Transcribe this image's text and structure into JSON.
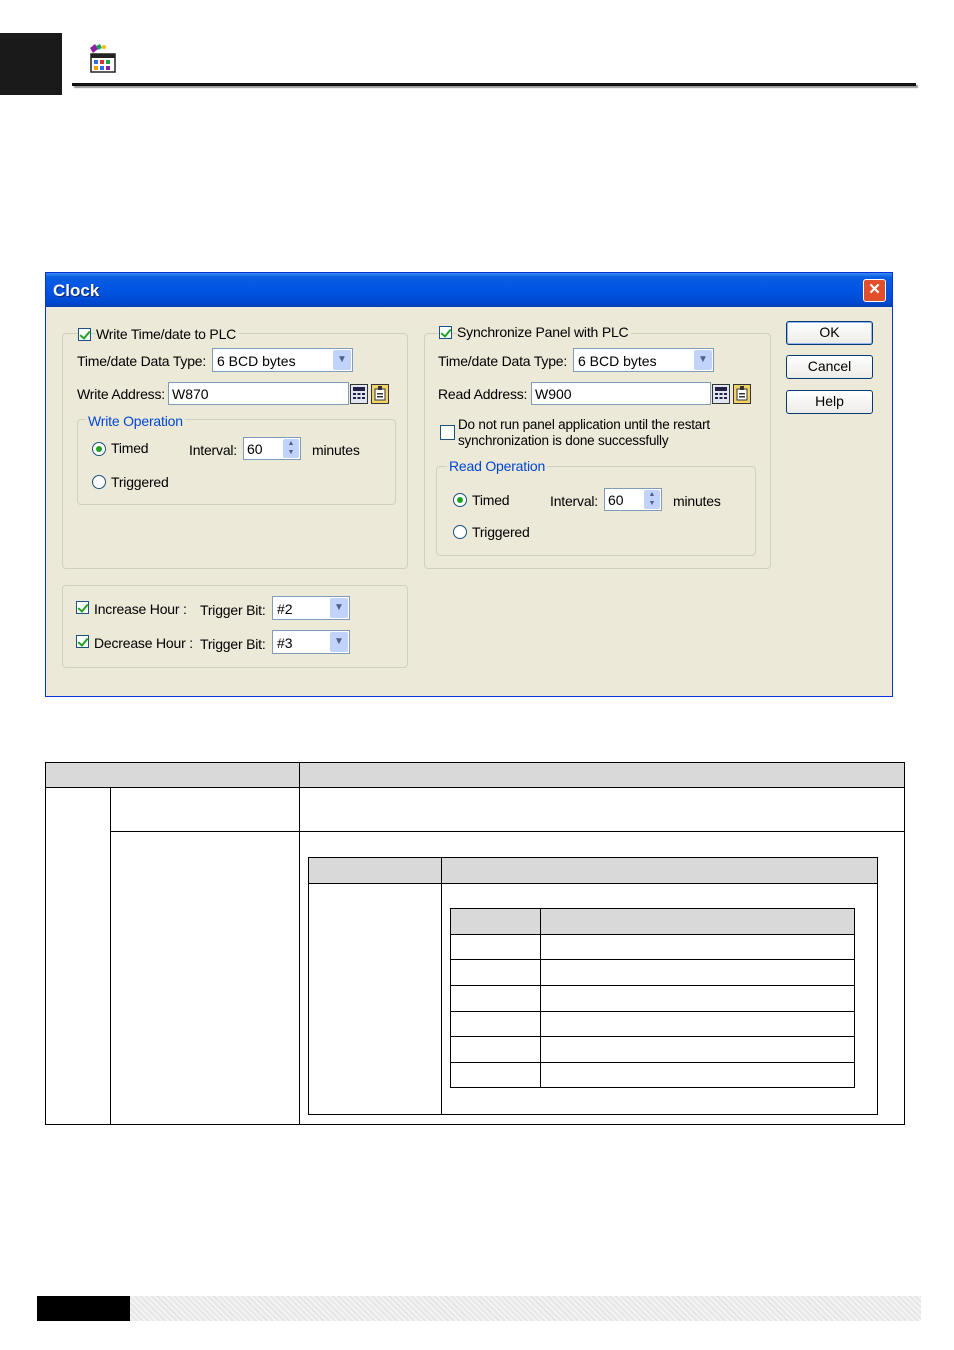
{
  "dialog": {
    "title": "Clock",
    "close_glyph": "✕",
    "write_group": {
      "enabled_label": "Write Time/date to PLC",
      "data_type_label": "Time/date Data Type:",
      "data_type_value": "6 BCD bytes",
      "address_label": "Write Address:",
      "address_value": "W870",
      "operation_label": "Write Operation",
      "timed_label": "Timed",
      "interval_label": "Interval:",
      "interval_value": "60",
      "minutes_label": "minutes",
      "triggered_label": "Triggered",
      "enabled": true,
      "mode": "Timed"
    },
    "sync_group": {
      "enabled_label": "Synchronize Panel with PLC",
      "data_type_label": "Time/date Data Type:",
      "data_type_value": "6 BCD bytes",
      "address_label": "Read Address:",
      "address_value": "W900",
      "no_run_label_1": "Do not run panel application until the restart",
      "no_run_label_2": "synchronization is done successfully",
      "operation_label": "Read Operation",
      "timed_label": "Timed",
      "interval_label": "Interval:",
      "interval_value": "60",
      "minutes_label": "minutes",
      "triggered_label": "Triggered",
      "enabled": true,
      "no_run_checked": false,
      "mode": "Timed"
    },
    "hour_group": {
      "increase_label": "Increase Hour :",
      "increase_trigger_label": "Trigger Bit:",
      "increase_trigger_value": "#2",
      "decrease_label": "Decrease Hour :",
      "decrease_trigger_label": "Trigger Bit:",
      "decrease_trigger_value": "#3",
      "increase_checked": true,
      "decrease_checked": true
    },
    "buttons": {
      "ok": "OK",
      "cancel": "Cancel",
      "help": "Help"
    }
  },
  "colors": {
    "titlebar": "#0054e3",
    "dialog_bg": "#ece9d8",
    "group_title": "#0046d5",
    "check_mark": "#21a121",
    "table_header": "#d9d9d9"
  }
}
